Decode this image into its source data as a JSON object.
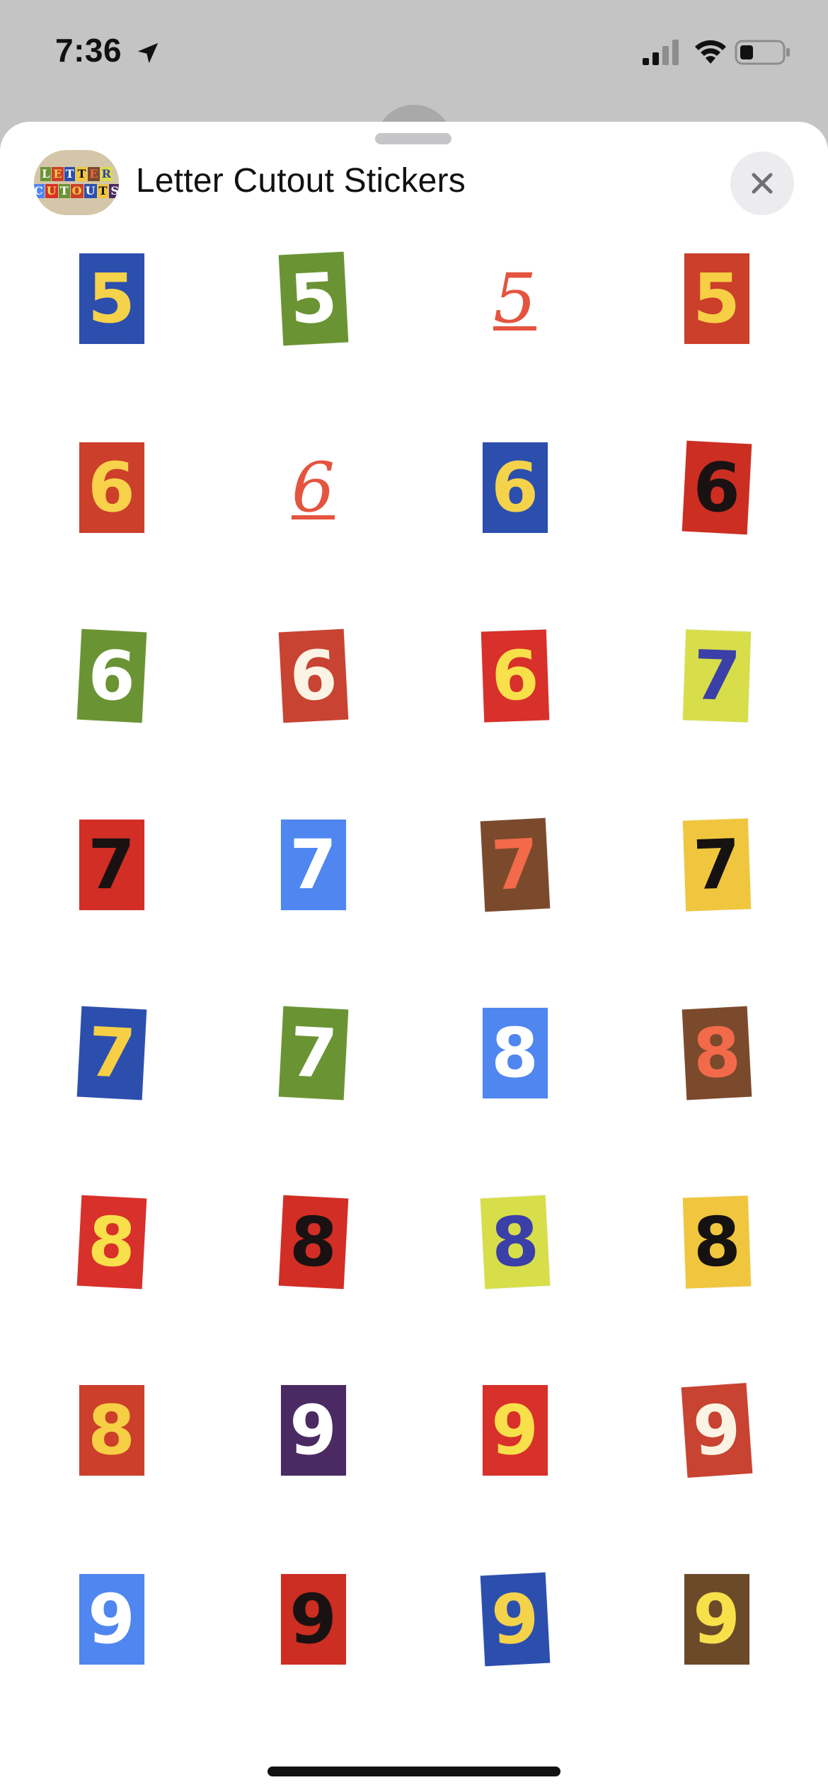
{
  "status_bar": {
    "time": "7:36",
    "icons": [
      "location-arrow-icon",
      "cellular-signal-icon",
      "wifi-icon",
      "battery-icon"
    ]
  },
  "sheet": {
    "title": "Letter Cutout Stickers",
    "app_icon_text": [
      "LETTER",
      "CUTOUTS"
    ],
    "close_icon": "close-icon"
  },
  "stickers": [
    {
      "char": "5",
      "bg": "#2c4fae",
      "fg": "#f4d24a",
      "rot": 0
    },
    {
      "char": "5",
      "bg": "#6a9433",
      "fg": "#ffffff",
      "rot": -3
    },
    {
      "char": "5",
      "bg": "none",
      "fg": "#e4543f",
      "rot": 0
    },
    {
      "char": "5",
      "bg": "#cc3f2a",
      "fg": "#f6cf45",
      "rot": 0
    },
    {
      "char": "6",
      "bg": "#cc3f2a",
      "fg": "#f8d24a",
      "rot": 0
    },
    {
      "char": "6",
      "bg": "none",
      "fg": "#e4543f",
      "rot": 0
    },
    {
      "char": "6",
      "bg": "#2c4fae",
      "fg": "#f4d24a",
      "rot": 0
    },
    {
      "char": "6",
      "bg": "#cc2e22",
      "fg": "#1a1212",
      "rot": 3
    },
    {
      "char": "6",
      "bg": "#6a9433",
      "fg": "#ffffff",
      "rot": 3
    },
    {
      "char": "6",
      "bg": "#c84331",
      "fg": "#fbf3e4",
      "rot": -3
    },
    {
      "char": "6",
      "bg": "#d8302a",
      "fg": "#f8e04a",
      "rot": -2
    },
    {
      "char": "7",
      "bg": "#d7de4a",
      "fg": "#3b3fa8",
      "rot": 2
    },
    {
      "char": "7",
      "bg": "#d22e25",
      "fg": "#1a1212",
      "rot": 0
    },
    {
      "char": "7",
      "bg": "#4f86f0",
      "fg": "#ffffff",
      "rot": 0
    },
    {
      "char": "7",
      "bg": "#7b4a2c",
      "fg": "#f26a4a",
      "rot": -3
    },
    {
      "char": "7",
      "bg": "#f0c63e",
      "fg": "#161212",
      "rot": -2
    },
    {
      "char": "7",
      "bg": "#2c4fae",
      "fg": "#f6cf45",
      "rot": 3
    },
    {
      "char": "7",
      "bg": "#6a9433",
      "fg": "#ffffff",
      "rot": 3
    },
    {
      "char": "8",
      "bg": "#4f86f0",
      "fg": "#ffffff",
      "rot": 0
    },
    {
      "char": "8",
      "bg": "#7b4a2c",
      "fg": "#f26a4a",
      "rot": -3
    },
    {
      "char": "8",
      "bg": "#d8302a",
      "fg": "#f8e04a",
      "rot": 3
    },
    {
      "char": "8",
      "bg": "#d22e25",
      "fg": "#1a1212",
      "rot": 3
    },
    {
      "char": "8",
      "bg": "#d7de4a",
      "fg": "#3b3fa8",
      "rot": -3
    },
    {
      "char": "8",
      "bg": "#f0c63e",
      "fg": "#161212",
      "rot": -2
    },
    {
      "char": "8",
      "bg": "#cc3f2a",
      "fg": "#f6cf45",
      "rot": 0
    },
    {
      "char": "9",
      "bg": "#4b2a63",
      "fg": "#ffffff",
      "rot": 0
    },
    {
      "char": "9",
      "bg": "#d8302a",
      "fg": "#f8e04a",
      "rot": 0
    },
    {
      "char": "9",
      "bg": "#c84331",
      "fg": "#fbf3e4",
      "rot": -4
    },
    {
      "char": "9",
      "bg": "#4f86f0",
      "fg": "#ffffff",
      "rot": 0
    },
    {
      "char": "9",
      "bg": "#cc2e22",
      "fg": "#1a1212",
      "rot": 0
    },
    {
      "char": "9",
      "bg": "#2c4fae",
      "fg": "#f4d24a",
      "rot": -3
    },
    {
      "char": "9",
      "bg": "#6b4a2a",
      "fg": "#f8e04a",
      "rot": 0
    }
  ]
}
